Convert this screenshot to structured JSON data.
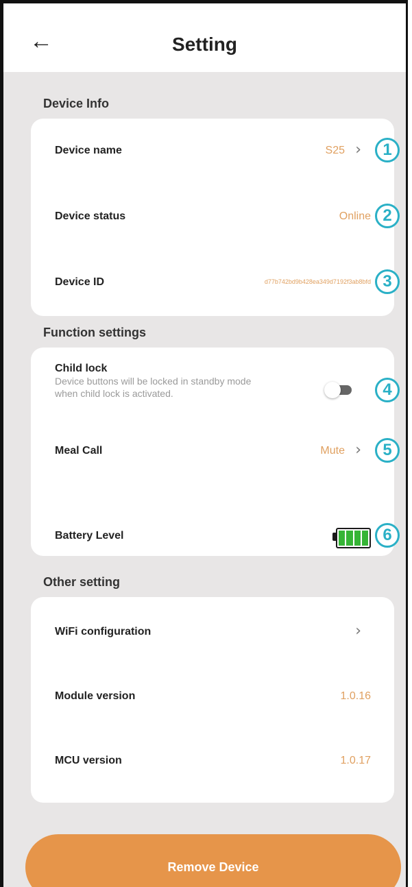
{
  "header": {
    "back_icon": "arrow-left-icon",
    "title": "Setting"
  },
  "sections": {
    "device_info": {
      "title": "Device Info",
      "device_name": {
        "label": "Device name",
        "value": "S25",
        "badge": "1"
      },
      "device_status": {
        "label": "Device status",
        "value": "Online",
        "badge": "2"
      },
      "device_id": {
        "label": "Device ID",
        "value": "d77b742bd9b428ea349d7192f3ab8bfd",
        "badge": "3"
      }
    },
    "function_settings": {
      "title": "Function settings",
      "child_lock": {
        "label": "Child lock",
        "description": "Device buttons will be locked in standby mode when child lock is activated.",
        "enabled": false,
        "badge": "4"
      },
      "meal_call": {
        "label": "Meal Call",
        "value": "Mute",
        "badge": "5"
      },
      "battery_level": {
        "label": "Battery Level",
        "level": 1.0,
        "badge": "6"
      }
    },
    "other_setting": {
      "title": "Other setting",
      "wifi": {
        "label": "WiFi configuration"
      },
      "module_version": {
        "label": "Module version",
        "value": "1.0.16"
      },
      "mcu_version": {
        "label": "MCU version",
        "value": "1.0.17"
      }
    }
  },
  "remove_button": {
    "label": "Remove Device"
  },
  "colors": {
    "accent": "#e6954a",
    "value_text": "#e0a060",
    "badge": "#2ab0c6",
    "battery": "#36b536",
    "background": "#e8e6e6"
  }
}
